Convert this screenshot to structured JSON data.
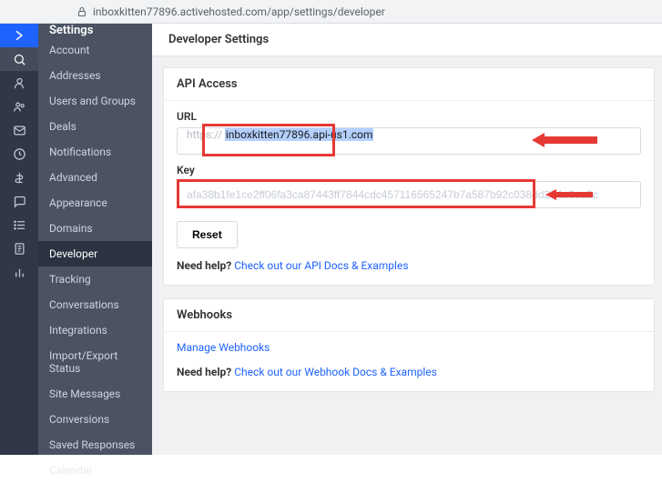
{
  "browser": {
    "url": "inboxkitten77896.activehosted.com/app/settings/developer"
  },
  "sidebarTitle": "Settings",
  "sidebar": {
    "account": "Account",
    "addresses": "Addresses",
    "users": "Users and Groups",
    "deals": "Deals",
    "notifications": "Notifications",
    "advanced": "Advanced",
    "appearance": "Appearance",
    "domains": "Domains",
    "developer": "Developer",
    "tracking": "Tracking",
    "conversations": "Conversations",
    "integrations": "Integrations",
    "importexport": "Import/Export Status",
    "sitemsg": "Site Messages",
    "conversions": "Conversions",
    "savedresp": "Saved Responses",
    "calendar": "Calendar"
  },
  "page": {
    "title": "Developer Settings",
    "api_access": "API Access",
    "url_label": "URL",
    "url_prefix": "https://",
    "url_value": "inboxkitten77896.api-us1.com",
    "key_label": "Key",
    "key_value": "afa38b1fe1ce2ff06fa3ca87443ff7844cdc457116565247b7a587b92c038dd264a0ea3c",
    "reset": "Reset",
    "help_prefix": "Need help? ",
    "help_api_link": "Check out our API Docs & Examples",
    "webhooks": "Webhooks",
    "manage_webhooks": "Manage Webhooks",
    "help_wh_link": "Check out our Webhook Docs & Examples"
  }
}
